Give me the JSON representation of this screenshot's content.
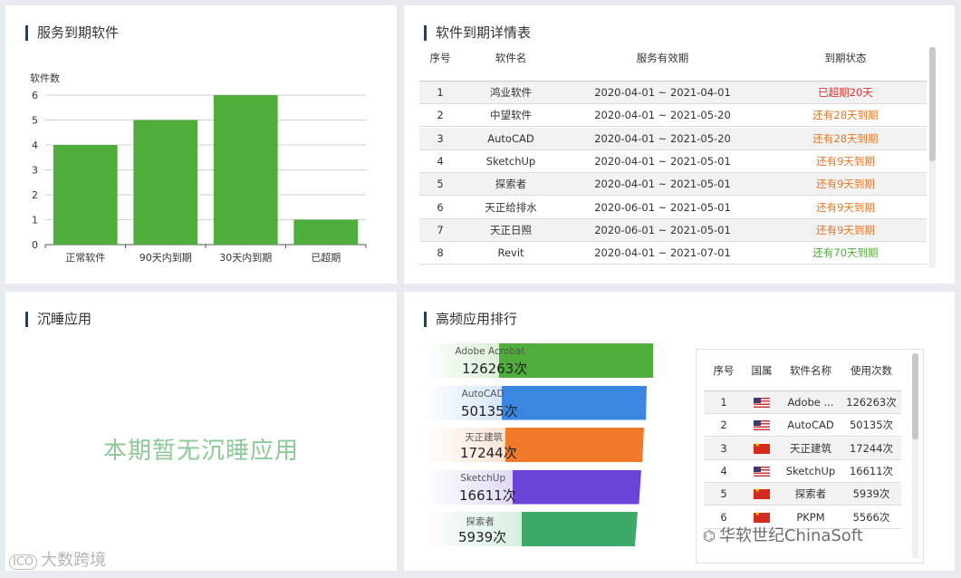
{
  "panels": {
    "service_expiry": {
      "title": "服务到期软件"
    },
    "expiry_detail": {
      "title": "软件到期详情表"
    },
    "dormant": {
      "title": "沉睡应用",
      "empty_message": "本期暂无沉睡应用"
    },
    "ranking": {
      "title": "高频应用排行"
    }
  },
  "chart_data": {
    "type": "bar",
    "title": "",
    "ylabel": "软件数",
    "xlabel": "",
    "categories": [
      "正常软件",
      "90天内到期",
      "30天内到期",
      "已超期"
    ],
    "values": [
      4,
      5,
      6,
      1
    ],
    "ylim": [
      0,
      6
    ],
    "yticks": [
      0,
      1,
      2,
      3,
      4,
      5,
      6
    ],
    "bar_color": "#4fae3b",
    "grid": true
  },
  "expiry_table": {
    "headers": [
      "序号",
      "软件名",
      "服务有效期",
      "到期状态"
    ],
    "rows": [
      {
        "no": "1",
        "name": "鸿业软件",
        "period": "2020-04-01 ~ 2021-04-01",
        "status": "已超期20天",
        "level": "red"
      },
      {
        "no": "2",
        "name": "中望软件",
        "period": "2020-04-01 ~ 2021-05-20",
        "status": "还有28天到期",
        "level": "orange"
      },
      {
        "no": "3",
        "name": "AutoCAD",
        "period": "2020-04-01 ~ 2021-05-20",
        "status": "还有28天到期",
        "level": "orange"
      },
      {
        "no": "4",
        "name": "SketchUp",
        "period": "2020-04-01 ~ 2021-05-01",
        "status": "还有9天到期",
        "level": "orange"
      },
      {
        "no": "5",
        "name": "探索者",
        "period": "2020-04-01 ~ 2021-05-01",
        "status": "还有9天到期",
        "level": "orange"
      },
      {
        "no": "6",
        "name": "天正给排水",
        "period": "2020-06-01 ~ 2021-05-01",
        "status": "还有9天到期",
        "level": "orange"
      },
      {
        "no": "7",
        "name": "天正日照",
        "period": "2020-06-01 ~ 2021-05-01",
        "status": "还有9天到期",
        "level": "orange"
      },
      {
        "no": "8",
        "name": "Revit",
        "period": "2020-04-01 ~ 2021-07-01",
        "status": "还有70天到期",
        "level": "green"
      }
    ],
    "colors": {
      "red": "#d9342b",
      "orange": "#e87722",
      "green": "#4fae3b"
    }
  },
  "ranking_funnel": [
    {
      "name": "Adobe Acrobat",
      "count": "126263次",
      "color": "#4fae3b"
    },
    {
      "name": "AutoCAD",
      "count": "50135次",
      "color": "#3a86e0"
    },
    {
      "name": "天正建筑",
      "count": "17244次",
      "color": "#f07a2a"
    },
    {
      "name": "SketchUp",
      "count": "16611次",
      "color": "#6c43d9"
    },
    {
      "name": "探索者",
      "count": "5939次",
      "color": "#3eaa6a"
    }
  ],
  "usage_table": {
    "headers": [
      "序号",
      "国属",
      "软件名称",
      "使用次数"
    ],
    "rows": [
      {
        "no": "1",
        "flag": "us",
        "name": "Adobe ...",
        "count": "126263次"
      },
      {
        "no": "2",
        "flag": "us",
        "name": "AutoCAD",
        "count": "50135次"
      },
      {
        "no": "3",
        "flag": "cn",
        "name": "天正建筑",
        "count": "17244次"
      },
      {
        "no": "4",
        "flag": "us",
        "name": "SketchUp",
        "count": "16611次"
      },
      {
        "no": "5",
        "flag": "cn",
        "name": "探索者",
        "count": "5939次"
      },
      {
        "no": "6",
        "flag": "cn",
        "name": "PKPM",
        "count": "5566次"
      }
    ]
  },
  "watermarks": {
    "left": "大数跨境",
    "right": "华软世纪ChinaSoft"
  }
}
